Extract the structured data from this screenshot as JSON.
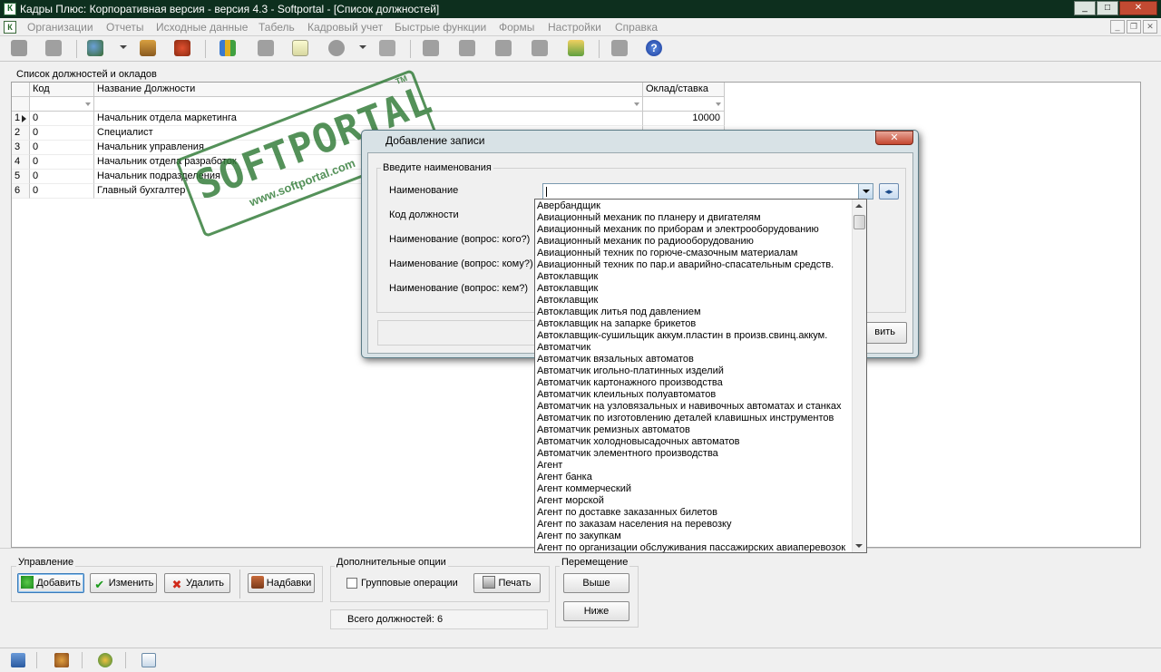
{
  "window": {
    "title": "Кадры Плюс: Корпоративная версия - версия 4.3 - Softportal - [Список должностей]"
  },
  "menu": [
    "Организации",
    "Отчеты",
    "Исходные данные",
    "Табель",
    "Кадровый учет",
    "Быстрые функции",
    "Формы",
    "Настройки",
    "Справка"
  ],
  "grid": {
    "group_label": "Список должностей и окладов",
    "headers": {
      "code": "Код",
      "name": "Название Должности",
      "salary": "Оклад/ставка"
    },
    "rows": [
      {
        "n": "1",
        "code": "0",
        "name": "Начальник отдела маркетинга",
        "salary": "10000"
      },
      {
        "n": "2",
        "code": "0",
        "name": "Специалист",
        "salary": ""
      },
      {
        "n": "3",
        "code": "0",
        "name": "Начальник управления",
        "salary": ""
      },
      {
        "n": "4",
        "code": "0",
        "name": "Начальник отдела разработок",
        "salary": ""
      },
      {
        "n": "5",
        "code": "0",
        "name": "Начальник подразделения",
        "salary": ""
      },
      {
        "n": "6",
        "code": "0",
        "name": "Главный бухгалтер",
        "salary": ""
      }
    ]
  },
  "bottom": {
    "manage_label": "Управление",
    "add": "Добавить",
    "edit": "Изменить",
    "delete": "Удалить",
    "bonus": "Надбавки",
    "options_label": "Дополнительные опции",
    "group_ops": "Групповые операции",
    "print": "Печать",
    "move_label": "Перемещение",
    "up": "Выше",
    "down": "Ниже",
    "total": "Всего должностей: 6"
  },
  "dialog": {
    "title": "Добавление записи",
    "group": "Введите наименования",
    "f_name": "Наименование",
    "f_code": "Код должности",
    "f_whom": "Наименование (вопрос: кого?)",
    "f_towhom": "Наименование (вопрос: кому?)",
    "f_bywhom": "Наименование (вопрос: кем?)",
    "ok_partial": "вить",
    "name_value": ""
  },
  "dropdown": [
    "Авербандщик",
    "Авиационный механик по планеру и двигателям",
    "Авиационный механик по приборам и электрооборудованию",
    "Авиационный механик по радиооборудованию",
    "Авиационный техник по горюче-смазочным материалам",
    "Авиационный техник по пар.и аварийно-спасательным средств.",
    "Автоклавщик",
    "Автоклавщик",
    "Автоклавщик",
    "Автоклавщик литья под давлением",
    "Автоклавщик на запарке брикетов",
    "Автоклавщик-сушильщик аккум.пластин в произв.свинц.аккум.",
    "Автоматчик",
    "Автоматчик вязальных автоматов",
    "Автоматчик игольно-платинных изделий",
    "Автоматчик картонажного производства",
    "Автоматчик клеильных полуавтоматов",
    "Автоматчик на узловязальных и навивочных автоматах и станках",
    "Автоматчик по изготовлению деталей клавишных инструментов",
    "Автоматчик ремизных автоматов",
    "Автоматчик холодновысадочных автоматов",
    "Автоматчик элементного производства",
    "Агент",
    "Агент банка",
    "Агент коммерческий",
    "Агент морской",
    "Агент по доставке заказанных билетов",
    "Агент по заказам населения на перевозку",
    "Агент по закупкам",
    "Агент по организации обслуживания пассажирских авиаперевозок"
  ],
  "watermark": {
    "brand": "SOFTPORTAL",
    "url": "www.softportal.com",
    "tm": "TM"
  },
  "colors": {
    "titlebar": "#0d2f1e",
    "watermark": "#2f7a35"
  }
}
